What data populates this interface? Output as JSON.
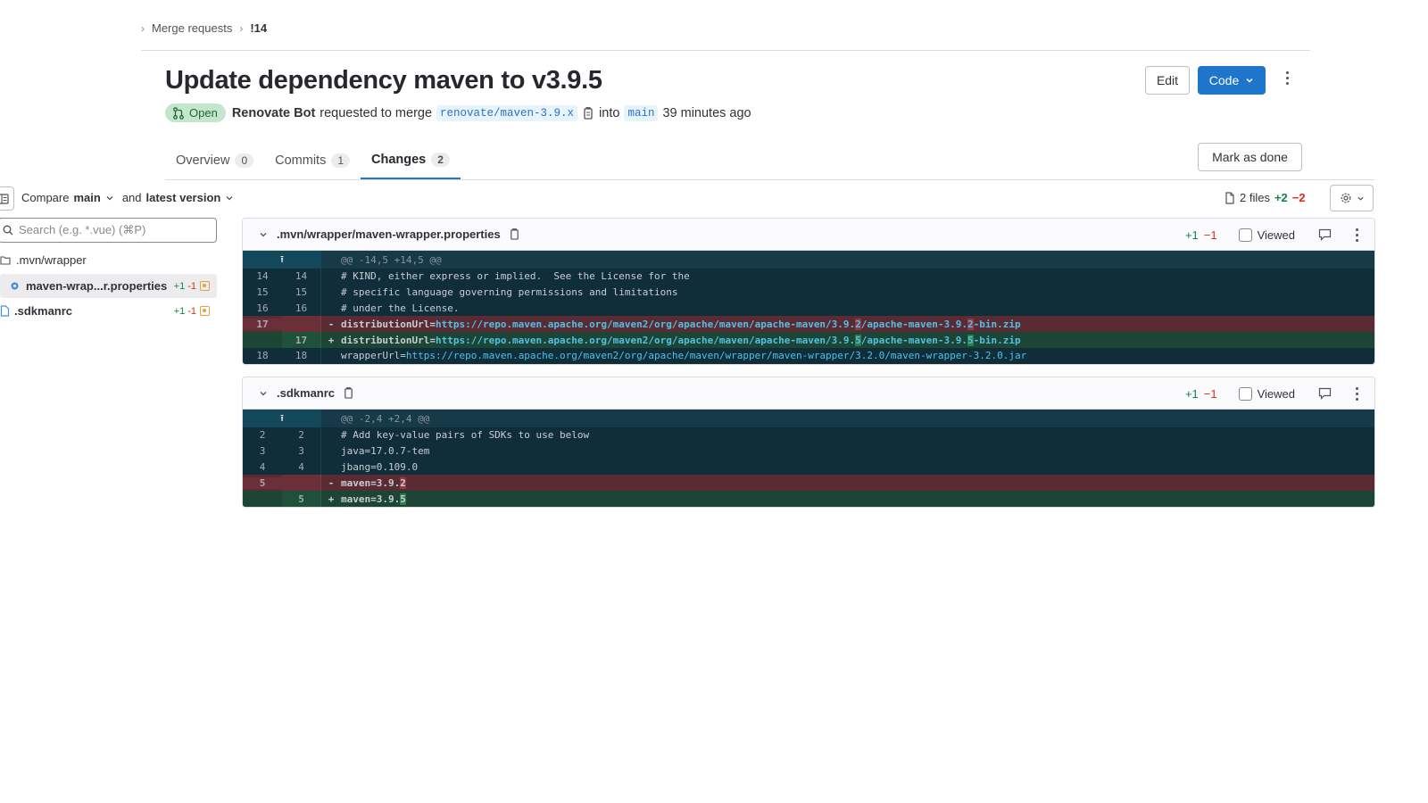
{
  "breadcrumb": {
    "item1": "Merge requests",
    "item2": "!14"
  },
  "mr": {
    "title": "Update dependency maven to v3.9.5",
    "status": "Open",
    "author": "Renovate Bot",
    "requested_text": "requested to merge",
    "source_branch": "renovate/maven-3.9.x",
    "into_text": "into",
    "target_branch": "main",
    "time_ago": "39 minutes ago"
  },
  "actions": {
    "edit": "Edit",
    "code": "Code",
    "mark_done": "Mark as done"
  },
  "tabs": [
    {
      "label": "Overview",
      "count": "0"
    },
    {
      "label": "Commits",
      "count": "1"
    },
    {
      "label": "Changes",
      "count": "2"
    }
  ],
  "compare": {
    "label": "Compare",
    "base": "main",
    "and": "and",
    "head": "latest version"
  },
  "stats": {
    "files": "2 files",
    "additions": "+2",
    "deletions": "−2"
  },
  "search": {
    "placeholder": "Search (e.g. *.vue) (⌘P)"
  },
  "tree": {
    "folder": ".mvn/wrapper",
    "files": [
      {
        "name": "maven-wrap...r.properties",
        "add": "+1",
        "del": "-1"
      },
      {
        "name": ".sdkmanrc",
        "add": "+1",
        "del": "-1"
      }
    ]
  },
  "diffs": [
    {
      "path": ".mvn/wrapper/maven-wrapper.properties",
      "add": "+1",
      "del": "−1",
      "viewed": "Viewed",
      "hunk": "@@ -14,5 +14,5 @@",
      "lines": [
        {
          "old": "14",
          "new": "14",
          "text": "# KIND, either express or implied.  See the License for the"
        },
        {
          "old": "15",
          "new": "15",
          "text": "# specific language governing permissions and limitations"
        },
        {
          "old": "16",
          "new": "16",
          "text": "# under the License."
        },
        {
          "old": "17",
          "new": "",
          "prefix": "distributionUrl=",
          "url_a": "https://repo.maven.apache.org/maven2/org/apache/maven/apache-maven/3.9.",
          "hl1": "2",
          "url_b": "/apache-maven-3.9.",
          "hl2": "2",
          "url_c": "-bin.zip"
        },
        {
          "old": "",
          "new": "17",
          "prefix": "distributionUrl=",
          "url_a": "https://repo.maven.apache.org/maven2/org/apache/maven/apache-maven/3.9.",
          "hl1": "5",
          "url_b": "/apache-maven-3.9.",
          "hl2": "5",
          "url_c": "-bin.zip"
        },
        {
          "old": "18",
          "new": "18",
          "prefix": "wrapperUrl=",
          "url": "https://repo.maven.apache.org/maven2/org/apache/maven/wrapper/maven-wrapper/3.2.0/maven-wrapper-3.2.0.jar"
        }
      ]
    },
    {
      "path": ".sdkmanrc",
      "add": "+1",
      "del": "−1",
      "viewed": "Viewed",
      "hunk": "@@ -2,4 +2,4 @@",
      "lines": [
        {
          "old": "2",
          "new": "2",
          "text": "# Add key-value pairs of SDKs to use below"
        },
        {
          "old": "3",
          "new": "3",
          "text": "java=17.0.7-tem"
        },
        {
          "old": "4",
          "new": "4",
          "text": "jbang=0.109.0"
        },
        {
          "old": "5",
          "new": "",
          "text": "maven=3.9.",
          "hl": "2"
        },
        {
          "old": "",
          "new": "5",
          "text": "maven=3.9.",
          "hl": "5"
        }
      ]
    }
  ],
  "diff_markers": {
    "del": "-",
    "add": "+"
  },
  "icons": [
    "chevron-right-icon",
    "merge-request-icon",
    "copy-icon",
    "chevron-down-icon",
    "kebab-icon",
    "file-tree-icon",
    "files-icon",
    "settings-icon",
    "search-icon",
    "folder-icon",
    "file-icon",
    "comment-icon",
    "expand-up-icon"
  ],
  "colors": {
    "primary": "#1f75cb",
    "added": "#108548",
    "removed": "#dd2b0e",
    "modified": "#e9a03b",
    "diff_bg": "#102e39"
  }
}
